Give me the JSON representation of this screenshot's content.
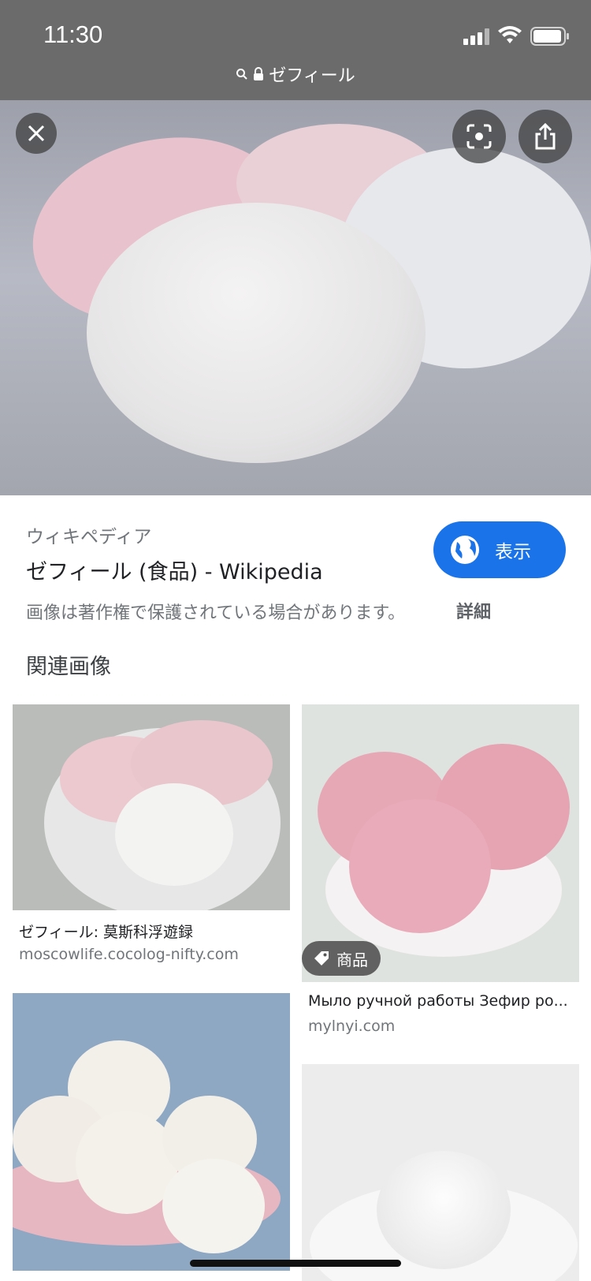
{
  "status": {
    "time": "11:30"
  },
  "url_bar": {
    "text": "ゼフィール"
  },
  "result": {
    "source": "ウィキペディア",
    "title": "ゼフィール (食品) - Wikipedia",
    "visit_label": "表示",
    "copyright_notice": "画像は著作権で保護されている場合があります。",
    "details_label": "詳細"
  },
  "related": {
    "heading": "関連画像",
    "items": [
      {
        "caption": "ゼフィール: 莫斯科浮遊録",
        "domain": "moscowlife.cocolog-nifty.com"
      },
      {
        "caption": "Мыло ручной работы Зефир ро...",
        "domain": "mylnyi.com",
        "badge": "商品"
      },
      {
        "caption": "",
        "domain": ""
      },
      {
        "caption": "",
        "domain": ""
      }
    ]
  },
  "icons": {
    "close": "close-icon",
    "lens": "lens-icon",
    "share": "share-icon",
    "globe": "globe-icon",
    "tag": "tag-icon"
  },
  "colors": {
    "accent": "#1a73e8",
    "topbar": "#6b6b6b"
  }
}
